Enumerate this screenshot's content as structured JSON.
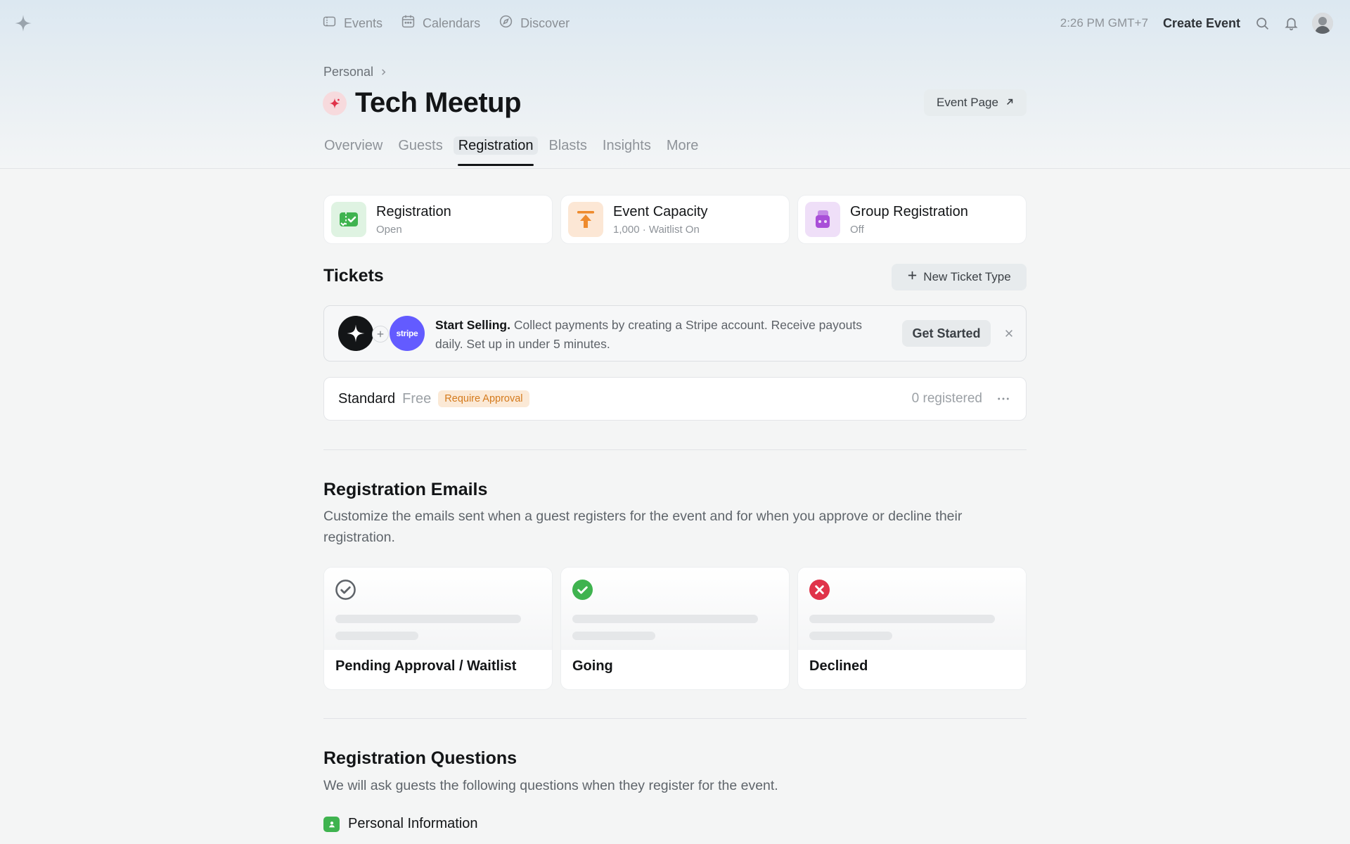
{
  "nav": {
    "items": [
      {
        "label": "Events",
        "icon": "ticket-icon"
      },
      {
        "label": "Calendars",
        "icon": "calendar-icon"
      },
      {
        "label": "Discover",
        "icon": "compass-icon"
      }
    ],
    "time": "2:26 PM GMT+7",
    "create_event": "Create Event"
  },
  "header": {
    "breadcrumb": "Personal",
    "title": "Tech Meetup",
    "event_page_label": "Event Page",
    "tabs": [
      "Overview",
      "Guests",
      "Registration",
      "Blasts",
      "Insights",
      "More"
    ],
    "active_tab": "Registration"
  },
  "features": [
    {
      "title": "Registration",
      "sub": "Open",
      "color": "#3fb34f",
      "icon": "ticket-check-icon"
    },
    {
      "title": "Event Capacity",
      "sub": "1,000 · Waitlist On",
      "color": "#ee8a2c",
      "icon": "capacity-arrow-icon"
    },
    {
      "title": "Group Registration",
      "sub": "Off",
      "color": "#a94fd8",
      "icon": "group-icon"
    }
  ],
  "tickets": {
    "title": "Tickets",
    "new_ticket_label": "New Ticket Type",
    "banner": {
      "bold": "Start Selling.",
      "text": "Collect payments by creating a Stripe account. Receive payouts daily. Set up in under 5 minutes.",
      "stripe_logo": "stripe",
      "cta": "Get Started"
    },
    "row": {
      "name": "Standard",
      "price": "Free",
      "badge": "Require Approval",
      "registered": "0 registered"
    }
  },
  "emails": {
    "title": "Registration Emails",
    "desc": "Customize the emails sent when a guest registers for the event and for when you approve or decline their registration.",
    "cards": [
      {
        "label": "Pending Approval / Waitlist",
        "status": "pending",
        "color": "#5e6369"
      },
      {
        "label": "Going",
        "status": "going",
        "color": "#3fb34f"
      },
      {
        "label": "Declined",
        "status": "declined",
        "color": "#e0334a"
      }
    ]
  },
  "questions": {
    "title": "Registration Questions",
    "desc": "We will ask guests the following questions when they register for the event.",
    "personal_info": "Personal Information"
  }
}
